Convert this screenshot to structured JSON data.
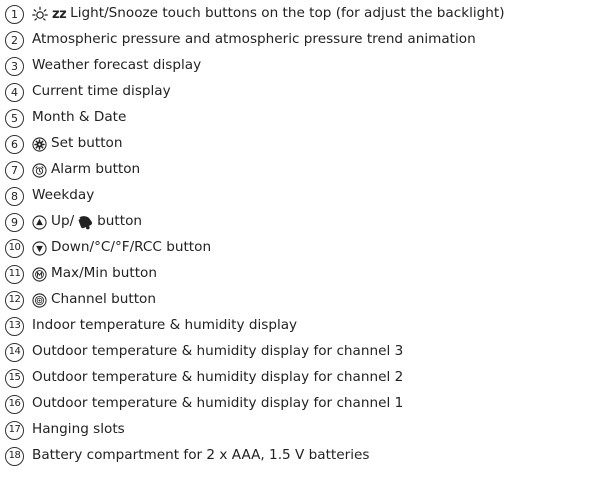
{
  "items": [
    {
      "num": "1",
      "label": "Light/Snooze touch buttons on the top (for adjust the backlight)",
      "icon": "sun-icon",
      "icon2": "snooze-zz-icon",
      "icon2_text": "zz"
    },
    {
      "num": "2",
      "label": "Atmospheric pressure and atmospheric pressure trend animation"
    },
    {
      "num": "3",
      "label": "Weather forecast display"
    },
    {
      "num": "4",
      "label": "Current time display"
    },
    {
      "num": "5",
      "label": "Month & Date"
    },
    {
      "num": "6",
      "label": "Set button",
      "icon": "gear-icon"
    },
    {
      "num": "7",
      "label": "Alarm button",
      "icon": "alarm-clock-icon"
    },
    {
      "num": "8",
      "label": "Weekday"
    },
    {
      "num": "9",
      "label_before": "Up/",
      "label": "button",
      "icon": "up-triangle-icon",
      "icon2": "bell-icon"
    },
    {
      "num": "10",
      "label": "Down/°C/°F/RCC button",
      "icon": "down-triangle-icon"
    },
    {
      "num": "11",
      "label": "Max/Min button",
      "icon": "max-min-icon"
    },
    {
      "num": "12",
      "label": "Channel button",
      "icon": "channel-icon"
    },
    {
      "num": "13",
      "label": "Indoor temperature & humidity display"
    },
    {
      "num": "14",
      "label": "Outdoor temperature & humidity display for channel 3"
    },
    {
      "num": "15",
      "label": "Outdoor temperature & humidity display for channel 2"
    },
    {
      "num": "16",
      "label": "Outdoor temperature & humidity display for channel 1"
    },
    {
      "num": "17",
      "label": "Hanging slots"
    },
    {
      "num": "18",
      "label": "Battery compartment for 2 x AAA, 1.5 V batteries"
    }
  ]
}
